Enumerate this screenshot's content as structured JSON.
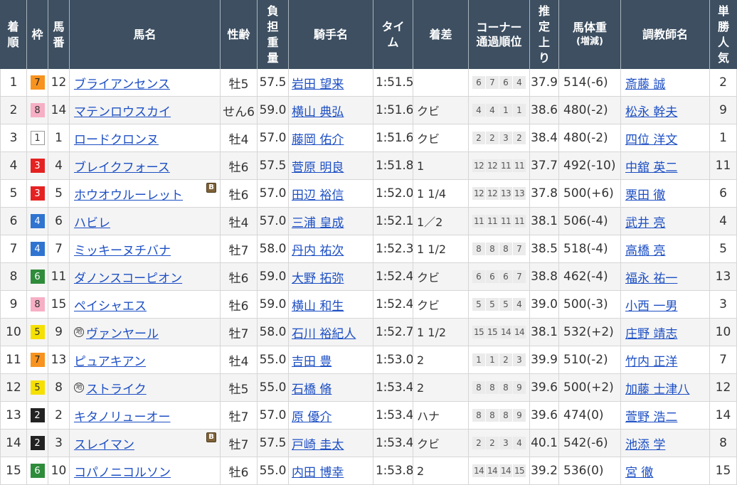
{
  "table": {
    "headers": {
      "rank": [
        "着",
        "順"
      ],
      "waku": [
        "枠"
      ],
      "umaban": [
        "馬",
        "番"
      ],
      "horse": [
        "馬名"
      ],
      "sex_age": [
        "性齢"
      ],
      "weight_carried": [
        "負",
        "担",
        "重",
        "量"
      ],
      "jockey": [
        "騎手名"
      ],
      "time": [
        "タイ",
        "ム"
      ],
      "margin": [
        "着差"
      ],
      "corners": [
        "コーナー",
        "通過順位"
      ],
      "last_3f": [
        "推",
        "定",
        "上",
        "り"
      ],
      "body_weight": [
        "馬体重",
        "(増減)"
      ],
      "trainer": [
        "調教師名"
      ],
      "popularity": [
        "単",
        "勝",
        "人",
        "気"
      ]
    },
    "rows": [
      {
        "rank": "1",
        "waku": "7",
        "umaban": "12",
        "horse": "ブライアンセンス",
        "sex_age": "牡5",
        "weight_carried": "57.5",
        "jockey": "岩田 望来",
        "time": "1:51.5",
        "corners": [
          "6",
          "7",
          "6",
          "4"
        ],
        "last_3f": "37.9",
        "body_weight": "514",
        "weight_change": "(-6)",
        "trainer": "斎藤 誠",
        "popularity": "2"
      },
      {
        "rank": "2",
        "waku": "8",
        "umaban": "14",
        "horse": "マテンロウスカイ",
        "sex_age": "せん6",
        "weight_carried": "59.0",
        "jockey": "横山 典弘",
        "time": "1:51.6",
        "margin": "クビ",
        "corners": [
          "4",
          "4",
          "1",
          "1"
        ],
        "last_3f": "38.6",
        "body_weight": "480",
        "weight_change": "(-2)",
        "trainer": "松永 幹夫",
        "popularity": "9"
      },
      {
        "rank": "3",
        "waku": "1",
        "umaban": "1",
        "horse": "ロードクロンヌ",
        "sex_age": "牡4",
        "weight_carried": "57.0",
        "jockey": "藤岡 佑介",
        "time": "1:51.6",
        "margin": "クビ",
        "corners": [
          "2",
          "2",
          "3",
          "2"
        ],
        "last_3f": "38.4",
        "body_weight": "480",
        "weight_change": "(-2)",
        "trainer": "四位 洋文",
        "popularity": "1"
      },
      {
        "rank": "4",
        "waku": "3",
        "umaban": "4",
        "horse": "ブレイクフォース",
        "sex_age": "牡6",
        "weight_carried": "57.5",
        "jockey": "菅原 明良",
        "time": "1:51.8",
        "margin": "1",
        "corners": [
          "12",
          "12",
          "11",
          "11"
        ],
        "last_3f": "37.7",
        "body_weight": "492",
        "weight_change": "(-10)",
        "trainer": "中舘 英二",
        "popularity": "11"
      },
      {
        "rank": "5",
        "waku": "3",
        "umaban": "5",
        "horse": "ホウオウルーレット",
        "badge": "B",
        "sex_age": "牡6",
        "weight_carried": "57.0",
        "jockey": "田辺 裕信",
        "time": "1:52.0",
        "margin": "1 1/4",
        "corners": [
          "12",
          "12",
          "13",
          "13"
        ],
        "last_3f": "37.8",
        "body_weight": "500",
        "weight_change": "(+6)",
        "trainer": "栗田 徹",
        "popularity": "6"
      },
      {
        "rank": "6",
        "waku": "4",
        "umaban": "6",
        "horse": "ハビレ",
        "sex_age": "牡4",
        "weight_carried": "57.0",
        "jockey": "三浦 皇成",
        "time": "1:52.1",
        "margin": "1／2",
        "corners": [
          "11",
          "11",
          "11",
          "11"
        ],
        "last_3f": "38.1",
        "body_weight": "506",
        "weight_change": "(-4)",
        "trainer": "武井 亮",
        "popularity": "4"
      },
      {
        "rank": "7",
        "waku": "4",
        "umaban": "7",
        "horse": "ミッキーヌチバナ",
        "sex_age": "牡7",
        "weight_carried": "58.0",
        "jockey": "丹内 祐次",
        "time": "1:52.3",
        "margin": "1 1/2",
        "corners": [
          "8",
          "8",
          "8",
          "7"
        ],
        "last_3f": "38.5",
        "body_weight": "518",
        "weight_change": "(-4)",
        "trainer": "高橋 亮",
        "popularity": "5"
      },
      {
        "rank": "8",
        "waku": "6",
        "umaban": "11",
        "horse": "ダノンスコーピオン",
        "sex_age": "牡6",
        "weight_carried": "59.0",
        "jockey": "大野 拓弥",
        "time": "1:52.4",
        "margin": "クビ",
        "corners": [
          "6",
          "6",
          "6",
          "7"
        ],
        "last_3f": "38.8",
        "body_weight": "462",
        "weight_change": "(-4)",
        "trainer": "福永 祐一",
        "popularity": "13"
      },
      {
        "rank": "9",
        "waku": "8",
        "umaban": "15",
        "horse": "ペイシャエス",
        "sex_age": "牡6",
        "weight_carried": "59.0",
        "jockey": "横山 和生",
        "time": "1:52.4",
        "margin": "クビ",
        "corners": [
          "5",
          "5",
          "5",
          "4"
        ],
        "last_3f": "39.0",
        "body_weight": "500",
        "weight_change": "(-3)",
        "trainer": "小西 一男",
        "popularity": "3"
      },
      {
        "rank": "10",
        "waku": "5",
        "umaban": "9",
        "marker": "地",
        "horse": "ヴァンヤール",
        "sex_age": "牡7",
        "weight_carried": "58.0",
        "jockey": "石川 裕紀人",
        "time": "1:52.7",
        "margin": "1 1/2",
        "corners": [
          "15",
          "15",
          "14",
          "14"
        ],
        "last_3f": "38.1",
        "body_weight": "532",
        "weight_change": "(+2)",
        "trainer": "庄野 靖志",
        "popularity": "10"
      },
      {
        "rank": "11",
        "waku": "7",
        "umaban": "13",
        "horse": "ピュアキアン",
        "sex_age": "牡4",
        "weight_carried": "55.0",
        "jockey": "吉田 豊",
        "time": "1:53.0",
        "margin": "2",
        "corners": [
          "1",
          "1",
          "2",
          "3"
        ],
        "last_3f": "39.9",
        "body_weight": "510",
        "weight_change": "(-2)",
        "trainer": "竹内 正洋",
        "popularity": "7"
      },
      {
        "rank": "12",
        "waku": "5",
        "umaban": "8",
        "marker": "地",
        "horse": "ストライク",
        "sex_age": "牡5",
        "weight_carried": "55.0",
        "jockey": "石橋 脩",
        "time": "1:53.4",
        "margin": "2",
        "corners": [
          "8",
          "8",
          "8",
          "9"
        ],
        "last_3f": "39.6",
        "body_weight": "500",
        "weight_change": "(+2)",
        "trainer": "加藤 士津八",
        "popularity": "12"
      },
      {
        "rank": "13",
        "waku": "2",
        "umaban": "2",
        "horse": "キタノリューオー",
        "sex_age": "牡7",
        "weight_carried": "57.0",
        "jockey": "原 優介",
        "time": "1:53.4",
        "margin": "ハナ",
        "corners": [
          "8",
          "8",
          "8",
          "9"
        ],
        "last_3f": "39.6",
        "body_weight": "474",
        "weight_change": "(0)",
        "trainer": "萱野 浩二",
        "popularity": "14"
      },
      {
        "rank": "14",
        "waku": "2",
        "umaban": "3",
        "horse": "スレイマン",
        "badge": "B",
        "sex_age": "牡7",
        "weight_carried": "57.5",
        "jockey": "戸崎 圭太",
        "time": "1:53.4",
        "margin": "クビ",
        "corners": [
          "2",
          "2",
          "3",
          "4"
        ],
        "last_3f": "40.1",
        "body_weight": "542",
        "weight_change": "(-6)",
        "trainer": "池添 学",
        "popularity": "8"
      },
      {
        "rank": "15",
        "waku": "6",
        "umaban": "10",
        "horse": "コパノニコルソン",
        "sex_age": "牡6",
        "weight_carried": "55.0",
        "jockey": "内田 博幸",
        "time": "1:53.8",
        "margin": "2",
        "corners": [
          "14",
          "14",
          "14",
          "15"
        ],
        "last_3f": "39.2",
        "body_weight": "536",
        "weight_change": "(0)",
        "trainer": "宮 徹",
        "popularity": "15"
      }
    ]
  },
  "waku_colors": {
    "1": {
      "bg": "#ffffff",
      "fg": "#333333",
      "border": "#999999"
    },
    "2": {
      "bg": "#222222",
      "fg": "#ffffff"
    },
    "3": {
      "bg": "#e52222",
      "fg": "#ffffff"
    },
    "4": {
      "bg": "#2f74d0",
      "fg": "#ffffff"
    },
    "5": {
      "bg": "#f6e000",
      "fg": "#333333"
    },
    "6": {
      "bg": "#2e8c3a",
      "fg": "#ffffff"
    },
    "7": {
      "bg": "#f7931e",
      "fg": "#222222"
    },
    "8": {
      "bg": "#f6afc4",
      "fg": "#333333"
    }
  },
  "colors": {
    "header_bg": "#3d4f61",
    "header_text": "#ffffff",
    "link": "#1d4fc4",
    "text": "#333333",
    "row_alt_bg": "#f4f4f4",
    "blinker_badge_bg": "#7f6238",
    "corner_box_bg": "#ebebeb"
  }
}
